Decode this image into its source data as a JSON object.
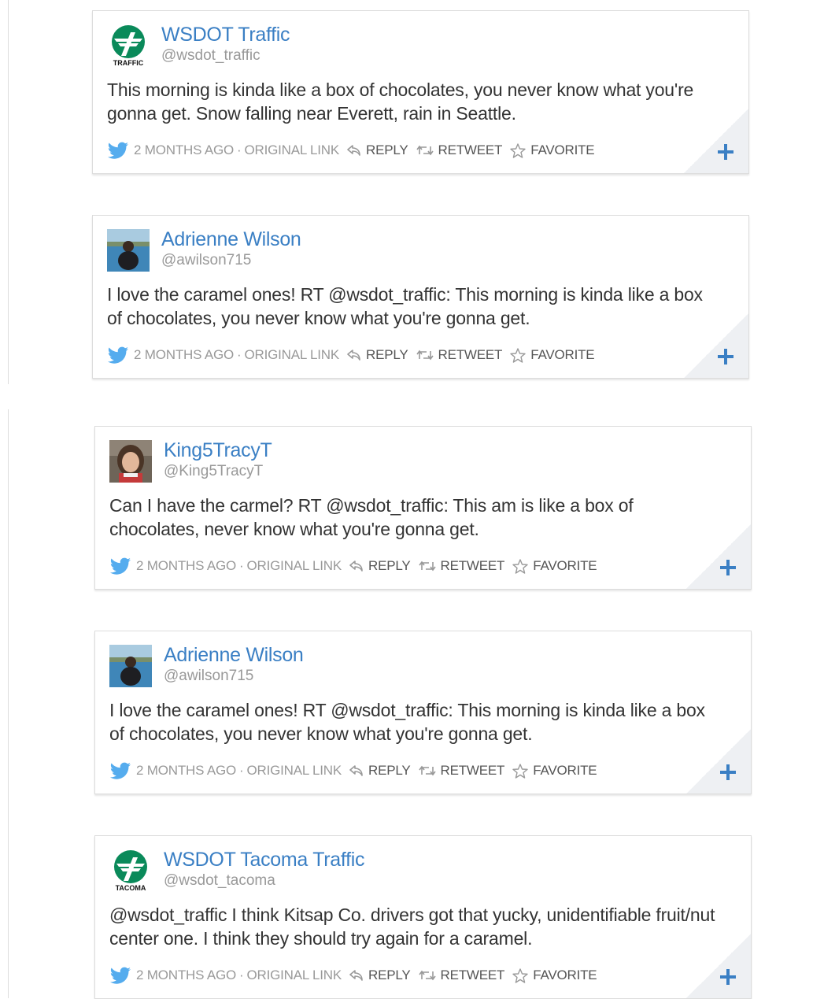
{
  "colors": {
    "name_link": "#3a7fc4",
    "handle": "#999999",
    "body_text": "#333333",
    "action_text": "#555555",
    "twitter_bird": "#55acee",
    "plus": "#3a7fc4",
    "wsdot_green": "#0a8a5a"
  },
  "tweets": [
    {
      "name": "WSDOT Traffic",
      "handle": "@wsdot_traffic",
      "avatar_icon": "wsdot-logo",
      "avatar_caption": "TRAFFIC",
      "text": "This morning is kinda like a box of chocolates, you never know what you're gonna get. Snow falling near Everett, rain in Seattle.",
      "time": "2 MONTHS AGO",
      "original_link": "ORIGINAL LINK",
      "reply": "REPLY",
      "retweet": "RETWEET",
      "favorite": "FAVORITE"
    },
    {
      "name": "Adrienne Wilson",
      "handle": "@awilson715",
      "avatar_icon": "user-photo-water",
      "text": "I love the caramel ones! RT @wsdot_traffic: This morning is kinda like a box of chocolates, you never know what you're gonna get.",
      "time": "2 MONTHS AGO",
      "original_link": "ORIGINAL LINK",
      "reply": "REPLY",
      "retweet": "RETWEET",
      "favorite": "FAVORITE"
    },
    {
      "name": "King5TracyT",
      "handle": "@King5TracyT",
      "avatar_icon": "user-photo-portrait",
      "text": "Can I have the carmel? RT @wsdot_traffic: This am is like a box of chocolates, never know what you're gonna get.",
      "time": "2 MONTHS AGO",
      "original_link": "ORIGINAL LINK",
      "reply": "REPLY",
      "retweet": "RETWEET",
      "favorite": "FAVORITE"
    },
    {
      "name": "Adrienne Wilson",
      "handle": "@awilson715",
      "avatar_icon": "user-photo-water",
      "text": "I love the caramel ones! RT @wsdot_traffic: This morning is kinda like a box of chocolates, you never know what you're gonna get.",
      "time": "2 MONTHS AGO",
      "original_link": "ORIGINAL LINK",
      "reply": "REPLY",
      "retweet": "RETWEET",
      "favorite": "FAVORITE"
    },
    {
      "name": "WSDOT Tacoma Traffic",
      "handle": "@wsdot_tacoma",
      "avatar_icon": "wsdot-logo",
      "avatar_caption": "TACOMA",
      "text": "@wsdot_traffic I think Kitsap Co. drivers got that yucky, unidentifiable fruit/nut center one. I think they should try again for a caramel.",
      "time": "2 MONTHS AGO",
      "original_link": "ORIGINAL LINK",
      "reply": "REPLY",
      "retweet": "RETWEET",
      "favorite": "FAVORITE"
    }
  ]
}
